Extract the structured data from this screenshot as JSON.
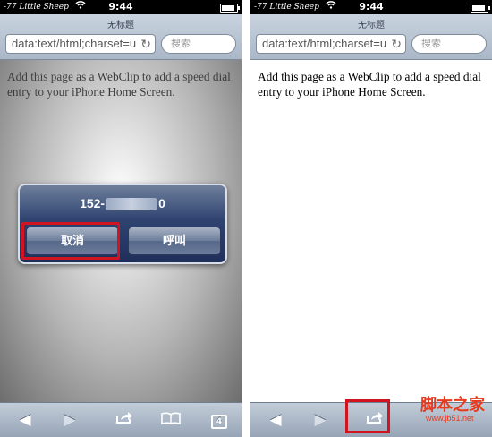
{
  "status": {
    "carrier": "-77 Little Sheep",
    "time": "9:44",
    "battery_level": 0.8
  },
  "browser": {
    "page_title": "无标题",
    "url": "data:text/html;charset=u",
    "search_placeholder": "搜索"
  },
  "content": {
    "text": "Add this page as a WebClip to add a speed dial entry to your iPhone Home Screen."
  },
  "alert": {
    "number_prefix": "152-",
    "number_suffix": "0",
    "cancel_label": "取消",
    "call_label": "呼叫"
  },
  "toolbar": {
    "pages_count": "4"
  },
  "icons": [
    "wifi-icon",
    "battery-icon",
    "reload-icon",
    "back-icon",
    "forward-icon",
    "share-icon",
    "bookmarks-icon",
    "pages-icon"
  ],
  "colors": {
    "highlight": "#d01420",
    "alert_bg": "#2f4370",
    "toolbar_bg": "#aab7c7"
  },
  "watermark": {
    "text": "脚本之家",
    "url": "www.jb51.net"
  }
}
